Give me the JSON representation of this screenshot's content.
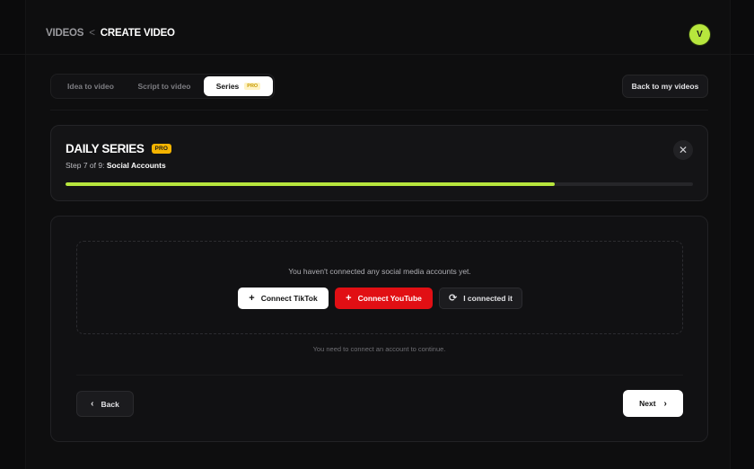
{
  "breadcrumb": {
    "root": "VIDEOS",
    "separator": "<",
    "current": "CREATE VIDEO"
  },
  "user": {
    "avatar_initial": "V",
    "avatar_color": "#b7e63d"
  },
  "tabs": [
    {
      "label": "Idea to video",
      "active": false
    },
    {
      "label": "Script to video",
      "active": false
    },
    {
      "label": "Series",
      "active": true,
      "badge": "PRO"
    }
  ],
  "back_to_videos_label": "Back to my videos",
  "series": {
    "title": "DAILY SERIES",
    "badge": "PRO",
    "step_prefix": "Step 7 of 9:",
    "step_name": "Social Accounts",
    "progress": 0.78,
    "progress_color": "#b7e63d",
    "close_icon": "close-icon"
  },
  "accounts": {
    "empty_message": "You haven't connected any social media accounts yet.",
    "buttons": [
      {
        "label": "Connect TikTok",
        "icon": "plus-icon"
      },
      {
        "label": "Connect YouTube",
        "icon": "plus-icon",
        "color": "#e10f14"
      },
      {
        "label": "I connected it",
        "icon": "refresh-icon"
      }
    ],
    "hint": "You need to connect an account to continue."
  },
  "nav": {
    "back_label": "Back",
    "next_label": "Next"
  }
}
